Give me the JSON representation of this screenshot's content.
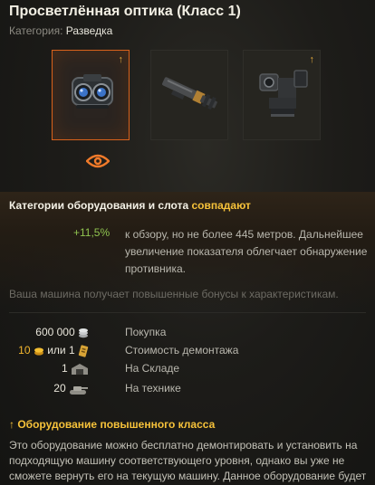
{
  "header": {
    "title": "Просветлённая оптика (Класс 1)",
    "category_label": "Категория:",
    "category_value": "Разведка"
  },
  "slots": [
    {
      "icon": "binocular-optics-icon",
      "selected": true,
      "upgrade_arrow": "↑"
    },
    {
      "icon": "rammer-cylinder-icon",
      "selected": false,
      "upgrade_arrow": ""
    },
    {
      "icon": "periscope-device-icon",
      "selected": false,
      "upgrade_arrow": "↑"
    }
  ],
  "slot_type_icon": "eye-icon",
  "match": {
    "prefix": "Категории оборудования и слота",
    "highlight": "совпадают"
  },
  "bonus": {
    "value": "+11,5%",
    "text": "к обзору, но не более 445 метров. Дальнейшее увеличение показателя облегчает обнаружение противника."
  },
  "note": "Ваша машина получает повышенные бонусы к характеристикам.",
  "stats": {
    "purchase": {
      "value": "600 000",
      "icon": "silver-coins-icon",
      "label": "Покупка"
    },
    "demount": {
      "gold": "10",
      "or": "или",
      "kits": "1",
      "gold_icon": "gold-coin-icon",
      "kit_icon": "demount-kit-icon",
      "label": "Стоимость демонтажа"
    },
    "storage": {
      "value": "1",
      "icon": "depot-icon",
      "label": "На Складе"
    },
    "vehicles": {
      "value": "20",
      "icon": "tank-icon",
      "label": "На технике"
    }
  },
  "enhanced": {
    "arrow": "↑",
    "title": "Оборудование повышенного класса",
    "description": "Это оборудование можно бесплатно демонтировать и установить на подходящую машину соответствующего уровня, однако вы уже не сможете вернуть его на текущую машину. Данное оборудование будет"
  },
  "colors": {
    "accent_orange": "#d9621c",
    "gold": "#f6c23a",
    "bonus_green": "#8fc34f"
  }
}
